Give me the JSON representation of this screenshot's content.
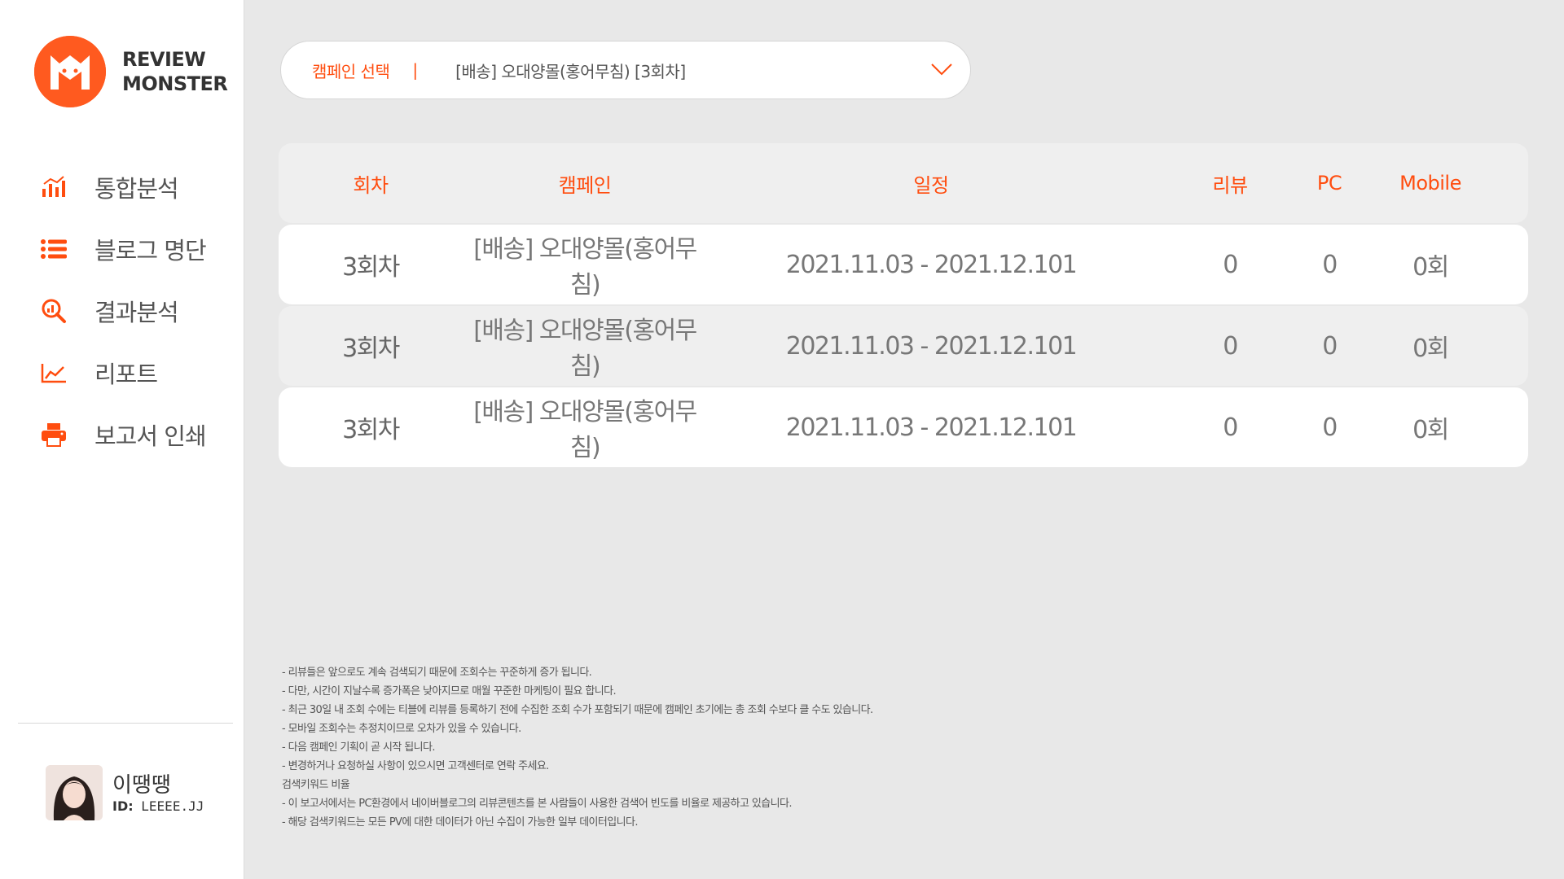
{
  "brand": {
    "line1": "REVIEW",
    "line2": "MONSTER",
    "accent": "#ff5a1f"
  },
  "nav": [
    {
      "label": "통합분석",
      "icon": "bar-chart-icon"
    },
    {
      "label": "블로그 명단",
      "icon": "list-icon"
    },
    {
      "label": "결과분석",
      "icon": "magnify-analysis-icon"
    },
    {
      "label": "리포트",
      "icon": "line-chart-icon"
    },
    {
      "label": "보고서 인쇄",
      "icon": "printer-icon"
    }
  ],
  "profile": {
    "name": "이땡땡",
    "id_label": "ID:",
    "id_value": "LEEEE.JJ"
  },
  "campaign_select": {
    "label": "캠페인 선택",
    "separator": "|",
    "value": "[배송]  오대양몰(홍어무침) [3회차]"
  },
  "table": {
    "headers": [
      "회차",
      "캠페인",
      "일정",
      "리뷰",
      "PC",
      "Mobile"
    ],
    "rows": [
      [
        "3회차",
        "[배송] 오대양몰(홍어무침)",
        "2021.11.03 - 2021.12.101",
        "0",
        "0",
        "0회"
      ],
      [
        "3회차",
        "[배송] 오대양몰(홍어무침)",
        "2021.11.03 - 2021.12.101",
        "0",
        "0",
        "0회"
      ],
      [
        "3회차",
        "[배송] 오대양몰(홍어무침)",
        "2021.11.03 - 2021.12.101",
        "0",
        "0",
        "0회"
      ]
    ]
  },
  "notes": [
    "- 리뷰들은 앞으로도 계속 검색되기 때문에 조회수는 꾸준하게 증가 됩니다.",
    "- 다만, 시간이 지날수록 증가폭은 낮아지므로 매월 꾸준한 마케팅이 필요 합니다.",
    "- 최근 30일 내 조회 수에는 티블에 리뷰를 등록하기 전에 수집한 조회 수가 포함되기 때문에 캠페인 초기에는 총 조회 수보다 클 수도 있습니다.",
    "- 모바일 조회수는 추정치이므로 오차가 있을 수 있습니다.",
    "- 다음 캠페인 기획이 곧 시작 됩니다.",
    "- 변경하거나 요청하실 사항이 있으시면 고객센터로 연락 주세요.",
    "검색키워드 비율",
    "- 이 보고서에서는 PC환경에서 네이버블로그의 리뷰콘텐츠를 본 사람들이 사용한 검색어 빈도를 비율로 제공하고 있습니다.",
    "- 해당 검색키워드는 모든 PV에 대한 데이터가 아닌 수집이 가능한 일부 데이터입니다."
  ]
}
